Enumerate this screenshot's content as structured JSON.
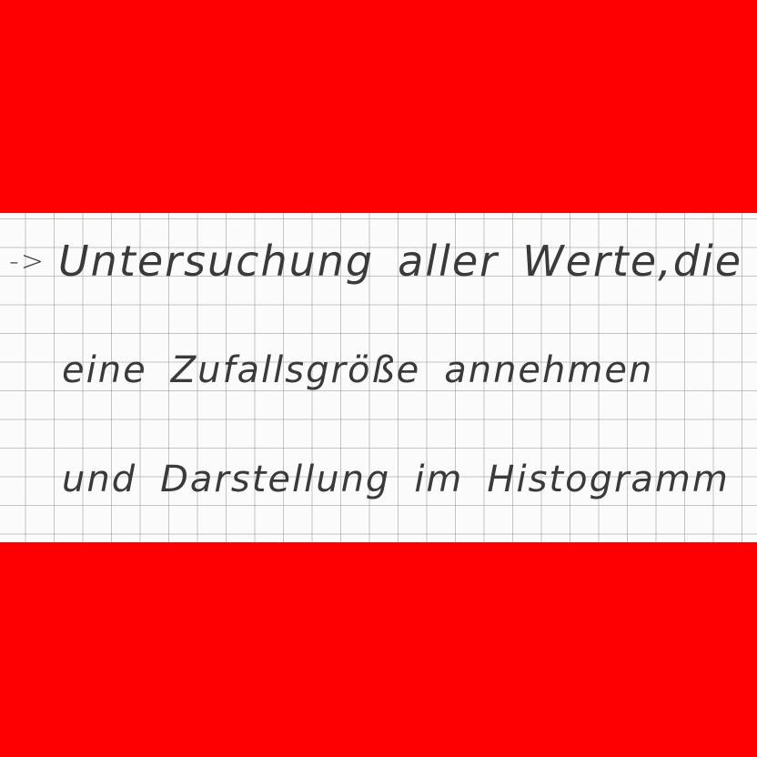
{
  "document": {
    "arrow": "->",
    "line1": {
      "w1": "Untersuchung",
      "w2": "aller",
      "w3": "Werte,",
      "w4": "die"
    },
    "line2": {
      "w1": "eine",
      "w2": "Zufallsgröße",
      "w3": "annehmen"
    },
    "line3": {
      "w1": "und",
      "w2": "Darstellung",
      "w3": "im",
      "w4": "Histogramm"
    }
  },
  "colors": {
    "border": "#ff0000",
    "paper": "#fbfbfb",
    "grid": "#969696",
    "ink": "#3a3a3a"
  }
}
